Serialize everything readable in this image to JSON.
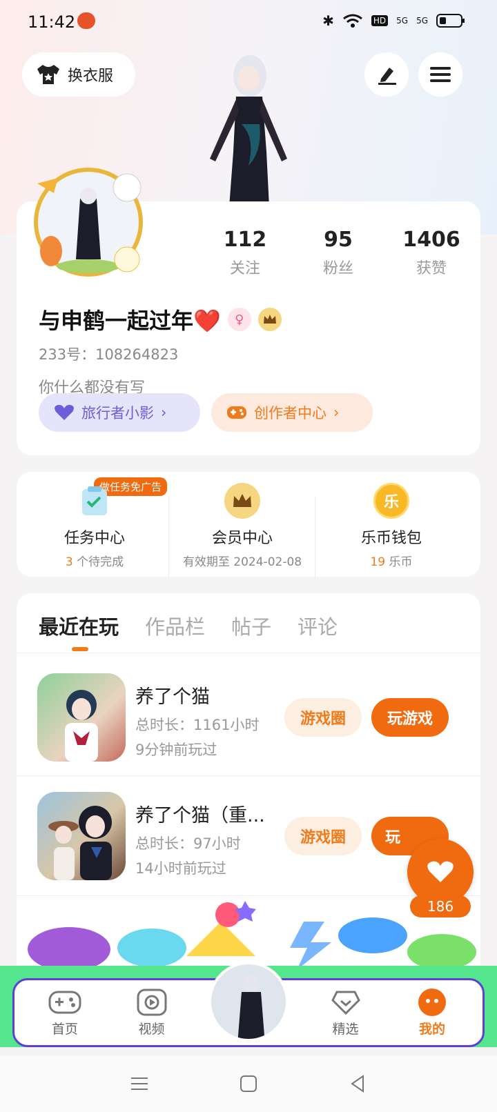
{
  "status": {
    "time": "11:42",
    "hd": "HD",
    "net1": "5G",
    "net2": "5G"
  },
  "header": {
    "outfit_label": "换衣服"
  },
  "profile": {
    "stats": [
      {
        "value": "112",
        "label": "关注"
      },
      {
        "value": "95",
        "label": "粉丝"
      },
      {
        "value": "1406",
        "label": "获赞"
      }
    ],
    "name": "与申鹤一起过年❤️",
    "uid": "233号：108264823",
    "bio": "你什么都没有写",
    "chips": [
      {
        "label": "旅行者小影"
      },
      {
        "label": "创作者中心"
      }
    ]
  },
  "services": [
    {
      "title": "任务中心",
      "count": "3",
      "suffix": " 个待完成",
      "tag": "做任务免广告"
    },
    {
      "title": "会员中心",
      "sub": "有效期至 2024-02-08"
    },
    {
      "title": "乐币钱包",
      "count": "19",
      "suffix": " 乐币",
      "icon_char": "乐"
    }
  ],
  "tabs": [
    "最近在玩",
    "作品栏",
    "帖子",
    "评论"
  ],
  "games": [
    {
      "name": "养了个猫",
      "duration": "总时长：1161小时",
      "last": "9分钟前玩过",
      "circle": "游戏圈",
      "play": "玩游戏"
    },
    {
      "name": "养了个猫（重...",
      "duration": "总时长：97小时",
      "last": "14小时前玩过",
      "circle": "游戏圈",
      "play": "玩"
    }
  ],
  "like_count": "186",
  "nav": [
    {
      "label": "首页"
    },
    {
      "label": "视频"
    },
    {
      "label": "精选"
    },
    {
      "label": "我的"
    }
  ],
  "colors": {
    "accent": "#f07b1a",
    "nav_border": "#5b3fd8",
    "nav_bg": "#55e58c"
  }
}
